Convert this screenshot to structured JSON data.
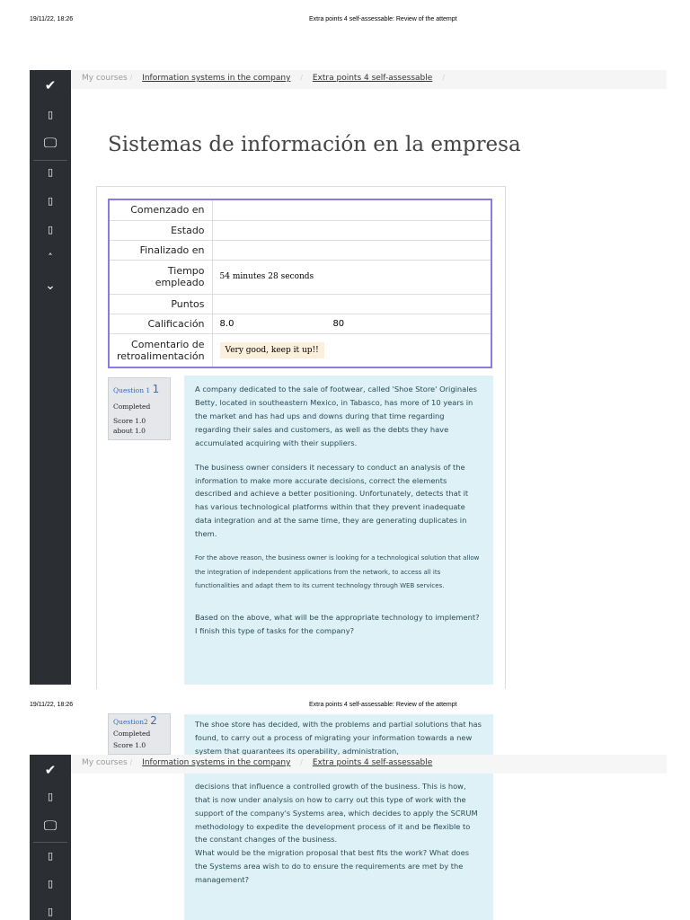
{
  "print_header": {
    "date": "19/11/22, 18:26",
    "title": "Extra points 4 self-assessable: Review of the attempt"
  },
  "breadcrumb": {
    "home": "My courses",
    "course": "Information systems in the company",
    "page": "Extra points 4 self-assessable",
    "sep": "/"
  },
  "page_title": "Sistemas de información en la empresa",
  "summary": [
    {
      "label": "Comenzado en",
      "value": ""
    },
    {
      "label": "Estado",
      "value": ""
    },
    {
      "label": "Finalizado en",
      "value": ""
    },
    {
      "label": "Tiempo empleado",
      "value": "54 minutes 28 seconds"
    },
    {
      "label": "Puntos",
      "value": ""
    },
    {
      "label": "Calificación",
      "value": "8.0",
      "value2": "80"
    },
    {
      "label": "Comentario de retroalimentación",
      "value": "Very good, keep it up!!"
    }
  ],
  "questions": [
    {
      "label": "Question 1",
      "num": "1",
      "state": "Completed",
      "score": "Score 1.0",
      "about": "about 1.0",
      "paragraphs": [
        "A company dedicated to the sale of footwear, called 'Shoe Store' Originales Betty, located in southeastern Mexico, in Tabasco, has more of 10 years in the market and has had ups and downs during that time regarding regarding their sales and customers, as well as the debts they have accumulated acquiring with their suppliers.",
        "The business owner considers it necessary to conduct an analysis of the information to make more accurate decisions, correct the elements described and achieve a better positioning. Unfortunately, detects that it has various technological platforms within that they prevent inadequate data integration and at the same time, they are generating duplicates in them.",
        "For the above reason, the business owner is looking for a technological solution that allow the integration of independent applications from the network, to access all its functionalities and adapt them to its current technology through WEB services.",
        "Based on the above, what will be the appropriate technology to implement? I finish this type of tasks for the company?"
      ]
    },
    {
      "label": "Question2",
      "num": "2",
      "state": "Completed",
      "score": "Score 1.0",
      "paragraphs": [
        "The shoe store has decided, with the problems and partial solutions that has found, to carry out a process of migrating your information towards a new system that guarantees its operability, administration,",
        "decisions that influence a controlled growth of the business. This is how, that is now under analysis on how to carry out this type of work with the support of the company's Systems area, which decides to apply the SCRUM methodology to expedite the development process of it and be flexible to the constant changes of the business.",
        "What would be the migration proposal that best fits the work? What does the Systems area wish to do to ensure the requirements are met by the management?"
      ]
    }
  ]
}
